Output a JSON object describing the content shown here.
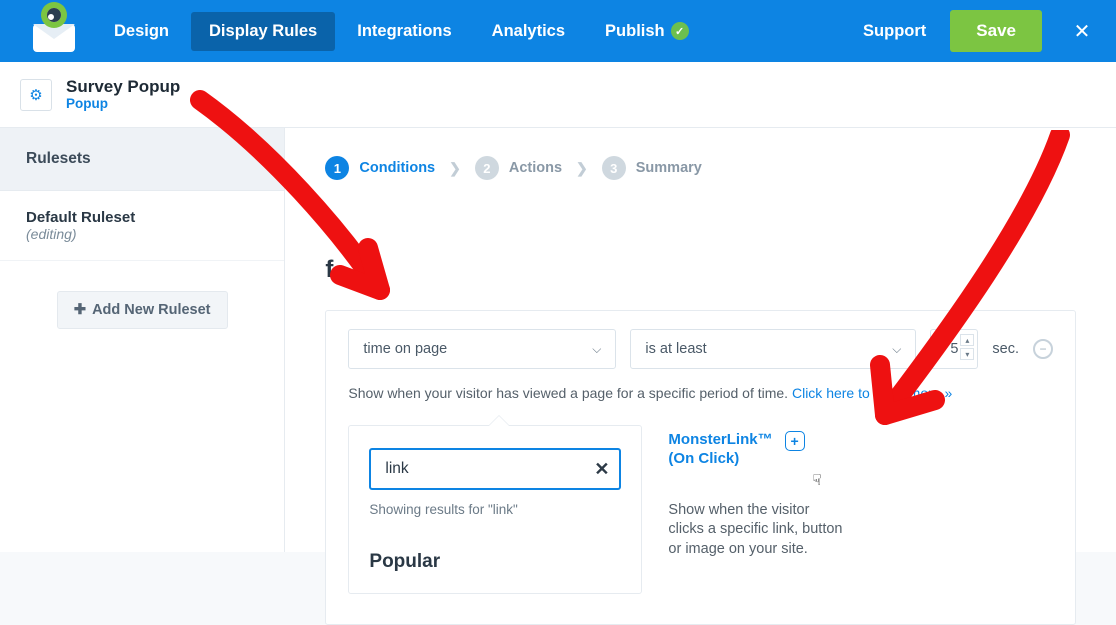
{
  "nav": {
    "tabs": [
      "Design",
      "Display Rules",
      "Integrations",
      "Analytics",
      "Publish"
    ],
    "active_index": 1,
    "publish_check": true,
    "support": "Support",
    "save": "Save"
  },
  "campaign": {
    "title": "Survey Popup",
    "type": "Popup"
  },
  "sidebar": {
    "header": "Rulesets",
    "items": [
      {
        "name": "Default Ruleset",
        "state": "(editing)"
      }
    ],
    "add_label": "Add New Ruleset"
  },
  "steps": [
    {
      "num": "1",
      "label": "Conditions",
      "active": true
    },
    {
      "num": "2",
      "label": "Actions",
      "active": false
    },
    {
      "num": "3",
      "label": "Summary",
      "active": false
    }
  ],
  "heading_fragment": "f...",
  "rule": {
    "condition_select": "time on page",
    "operator_select": "is at least",
    "value": "5",
    "unit": "sec.",
    "help_text": "Show when your visitor has viewed a page for a specific period of time. ",
    "help_link": "Click here to learn more »"
  },
  "dropdown": {
    "search_value": "link",
    "clear_icon": "✕",
    "results_label": "Showing results for \"link\"",
    "section_heading": "Popular"
  },
  "option": {
    "title_line1": "MonsterLink™",
    "title_line2": "(On Click)",
    "desc": "Show when the visitor clicks a specific link, button or image on your site."
  }
}
